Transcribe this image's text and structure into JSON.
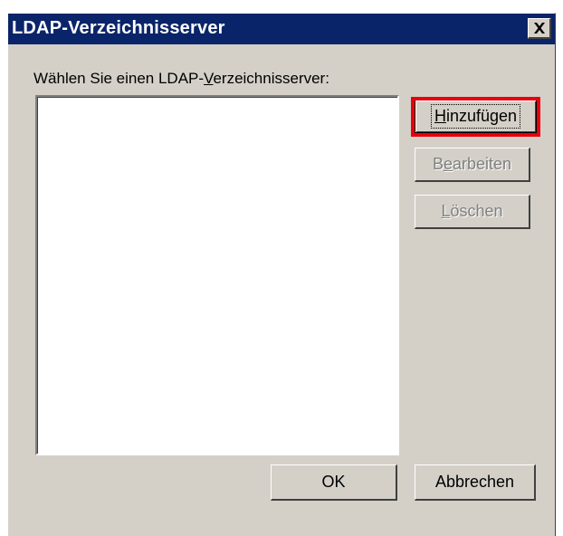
{
  "window": {
    "title": "LDAP-Verzeichnisserver",
    "close_icon": "close-icon"
  },
  "prompt": {
    "pre": "Wählen Sie einen LDAP-",
    "accel": "V",
    "post": "erzeichnisserver:"
  },
  "server_list": {
    "items": []
  },
  "buttons": {
    "add": {
      "accel": "H",
      "rest": "inzufügen",
      "enabled": true,
      "focused": true
    },
    "edit": {
      "pre": "B",
      "accel": "e",
      "rest": "arbeiten",
      "enabled": false
    },
    "delete": {
      "accel": "L",
      "rest": "öschen",
      "enabled": false
    },
    "ok": "OK",
    "cancel": "Abbrechen"
  },
  "colors": {
    "titlebar": "#0a246a",
    "dialog_face": "#d4d0c8",
    "highlight": "#e8000b",
    "disabled_text": "#808080"
  }
}
